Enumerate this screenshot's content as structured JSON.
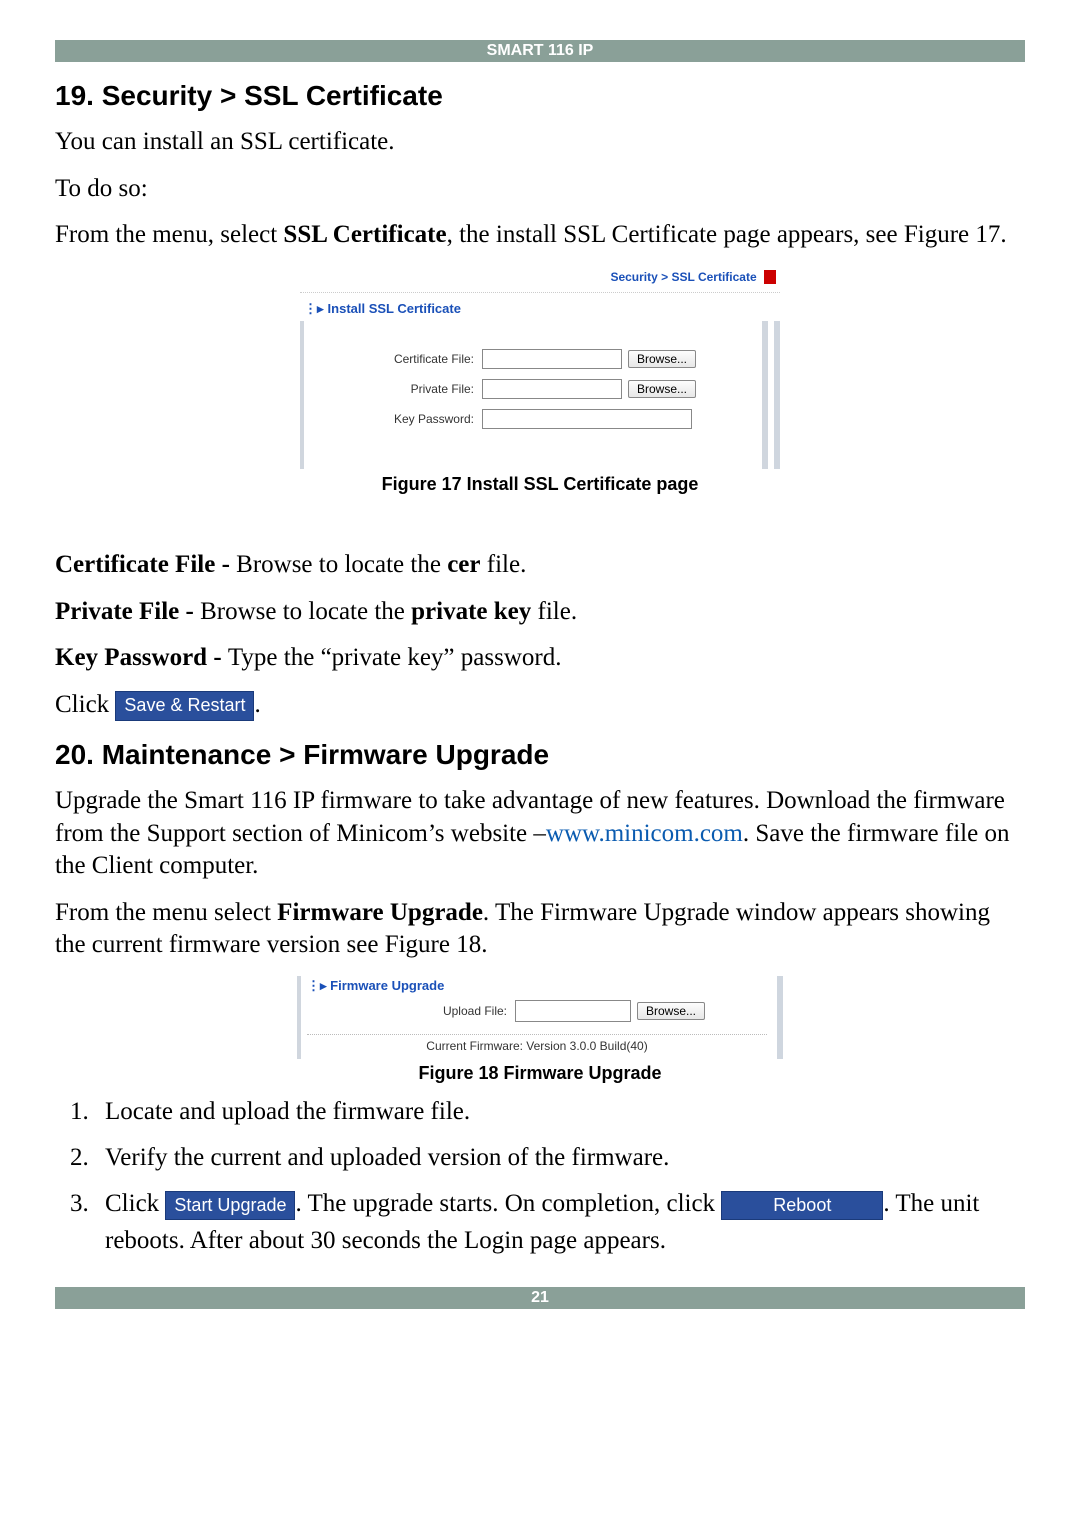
{
  "header": {
    "title": "SMART 116 IP"
  },
  "section19": {
    "heading": "19. Security > SSL Certificate",
    "p1": "You can install an SSL certificate.",
    "p2": "To do so:",
    "p3a": "From the menu, select ",
    "p3b": "SSL Certificate",
    "p3c": ", the install SSL Certificate page appears, see Figure 17."
  },
  "fig17": {
    "breadcrumb_a": "Security",
    "breadcrumb_sep": " > ",
    "breadcrumb_b": "SSL Certificate",
    "panel_title": "Install SSL Certificate",
    "rows": {
      "cert_label": "Certificate File:",
      "priv_label": "Private File:",
      "key_label": "Key Password:"
    },
    "browse": "Browse...",
    "caption": "Figure 17 Install SSL Certificate page"
  },
  "defs": {
    "cert_b": "Certificate File - ",
    "cert_t_a": "Browse to locate the ",
    "cert_t_b": "cer",
    "cert_t_c": " file.",
    "priv_b": "Private File - ",
    "priv_t_a": "Browse to locate the ",
    "priv_t_b": "private key",
    "priv_t_c": " file.",
    "key_b": "Key Password - ",
    "key_t": "Type the “private key” password.",
    "click": "Click ",
    "save_restart": "Save & Restart",
    "period": "."
  },
  "section20": {
    "heading": "20. Maintenance > Firmware Upgrade",
    "p1a": "Upgrade the Smart 116 IP firmware to take advantage of new features. Download the firmware from the Support section of Minicom’s website –",
    "p1_link": "www.minicom.com",
    "p1b": ". Save the firmware file on the Client computer.",
    "p2a": "From the menu select ",
    "p2b": "Firmware Upgrade",
    "p2c": ". The Firmware Upgrade window appears showing the current firmware version see Figure 18."
  },
  "fig18": {
    "title": "Firmware Upgrade",
    "upload_label": "Upload File:",
    "browse": "Browse...",
    "current": "Current Firmware: Version 3.0.0 Build(40)",
    "caption": "Figure 18 Firmware Upgrade"
  },
  "steps": {
    "s1": "Locate and upload the firmware file.",
    "s2": "Verify the current and uploaded version of the firmware.",
    "s3_a": "Click ",
    "s3_btn1": "Start Upgrade",
    "s3_b": ". The upgrade starts. On completion, click ",
    "s3_btn2": "Reboot",
    "s3_c": ". The unit reboots. After about 30 seconds the Login page appears."
  },
  "footer": {
    "page": "21"
  }
}
